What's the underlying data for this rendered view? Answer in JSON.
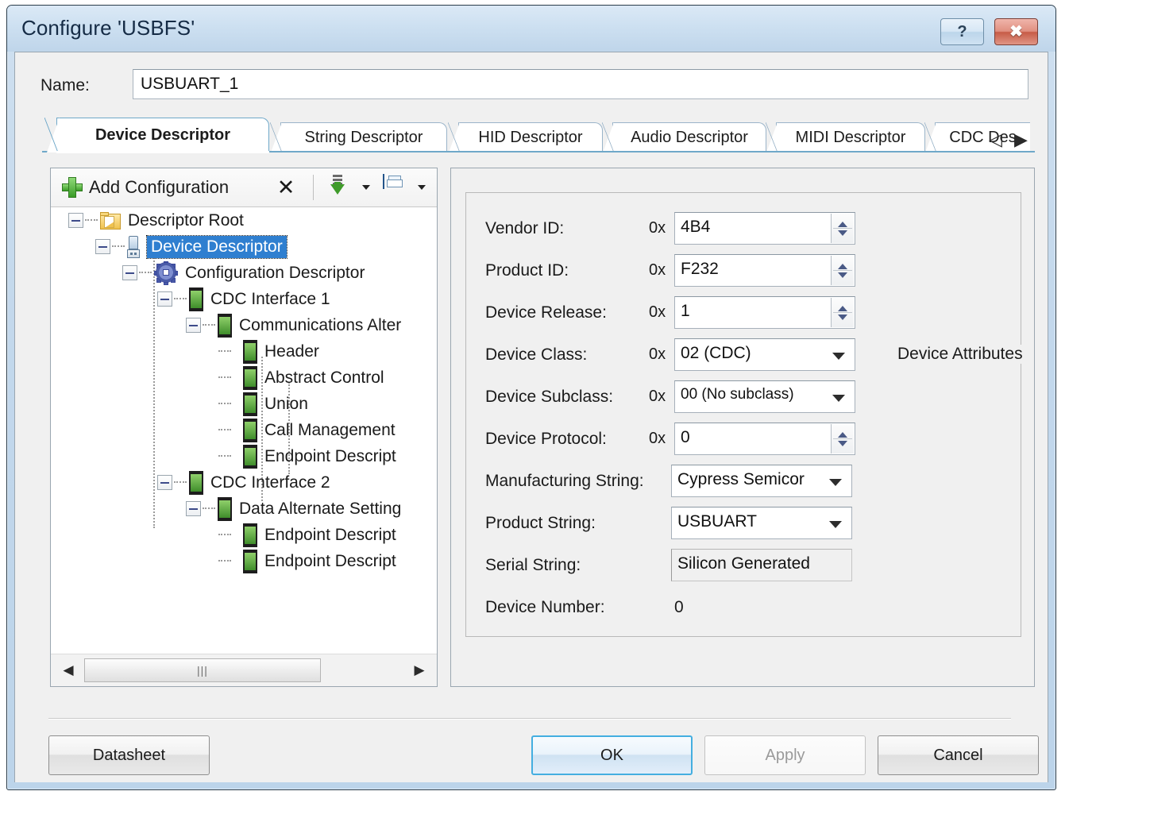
{
  "window": {
    "title": "Configure 'USBFS'",
    "help_button": "?",
    "close_button": "✖"
  },
  "name_row": {
    "label": "Name:",
    "value": "USBUART_1",
    "placeholder": "Name"
  },
  "tabs": {
    "items": [
      {
        "label": "Device Descriptor",
        "active": true
      },
      {
        "label": "String Descriptor",
        "active": false
      },
      {
        "label": "HID Descriptor",
        "active": false
      },
      {
        "label": "Audio Descriptor",
        "active": false
      },
      {
        "label": "MIDI Descriptor",
        "active": false
      },
      {
        "label": "CDC Des",
        "active": false
      }
    ],
    "scroll_left": "◁",
    "scroll_right": "▶"
  },
  "toolbar": {
    "add_configuration": "Add Configuration",
    "delete_label": "✕",
    "import_label": "",
    "save_label": ""
  },
  "tree": {
    "nodes": [
      {
        "label": "Descriptor Root",
        "depth": 0,
        "icon": "folder-icon",
        "expander": "collapse",
        "selected": false
      },
      {
        "label": "Device Descriptor",
        "depth": 1,
        "icon": "usb-device-icon",
        "expander": "collapse",
        "selected": true
      },
      {
        "label": "Configuration Descriptor",
        "depth": 2,
        "icon": "gear-icon",
        "expander": "collapse",
        "selected": false
      },
      {
        "label": "CDC Interface 1",
        "depth": 3,
        "icon": "chip-icon",
        "expander": "collapse",
        "selected": false
      },
      {
        "label": "Communications Alter",
        "depth": 4,
        "icon": "chip-icon",
        "expander": "collapse",
        "selected": false
      },
      {
        "label": "Header",
        "depth": 5,
        "icon": "chip-icon",
        "expander": "leaf",
        "selected": false
      },
      {
        "label": "Abstract Control",
        "depth": 5,
        "icon": "chip-icon",
        "expander": "leaf",
        "selected": false
      },
      {
        "label": "Union",
        "depth": 5,
        "icon": "chip-icon",
        "expander": "leaf",
        "selected": false
      },
      {
        "label": "Call Management",
        "depth": 5,
        "icon": "chip-icon",
        "expander": "leaf",
        "selected": false
      },
      {
        "label": "Endpoint Descript",
        "depth": 5,
        "icon": "chip-icon",
        "expander": "leaf",
        "selected": false
      },
      {
        "label": "CDC Interface 2",
        "depth": 3,
        "icon": "chip-icon",
        "expander": "collapse",
        "selected": false
      },
      {
        "label": "Data Alternate Setting",
        "depth": 4,
        "icon": "chip-icon",
        "expander": "collapse",
        "selected": false
      },
      {
        "label": "Endpoint Descript",
        "depth": 5,
        "icon": "chip-icon",
        "expander": "leaf",
        "selected": false
      },
      {
        "label": "Endpoint Descript",
        "depth": 5,
        "icon": "chip-icon",
        "expander": "leaf",
        "selected": false
      }
    ],
    "scrollbar": {
      "left_arrow": "◀",
      "right_arrow": "▶",
      "grip": "|||"
    }
  },
  "attributes": {
    "group_title": "Device Attributes",
    "hex_prefix": "0x",
    "fields": [
      {
        "label": "Vendor ID:",
        "hex": "0x",
        "value": "4B4",
        "control": "spinner"
      },
      {
        "label": "Product ID:",
        "hex": "0x",
        "value": "F232",
        "control": "spinner"
      },
      {
        "label": "Device Release:",
        "hex": "0x",
        "value": "1",
        "control": "spinner"
      },
      {
        "label": "Device Class:",
        "hex": "0x",
        "value": "02 (CDC)",
        "control": "dropdown"
      },
      {
        "label": "Device Subclass:",
        "hex": "0x",
        "value": "00 (No subclass)",
        "control": "dropdown"
      },
      {
        "label": "Device Protocol:",
        "hex": "0x",
        "value": "0",
        "control": "spinner"
      },
      {
        "label": "Manufacturing String:",
        "hex": "",
        "value": "Cypress Semicor",
        "control": "dropdown"
      },
      {
        "label": "Product String:",
        "hex": "",
        "value": "USBUART",
        "control": "dropdown"
      },
      {
        "label": "Serial String:",
        "hex": "",
        "value": "Silicon Generated",
        "control": "readonly"
      },
      {
        "label": "Device Number:",
        "hex": "",
        "value": "0",
        "control": "plain"
      }
    ]
  },
  "footer": {
    "datasheet": "Datasheet",
    "ok": "OK",
    "apply": "Apply",
    "cancel": "Cancel"
  },
  "colors": {
    "accent": "#2f7fd0",
    "tab_underline": "#6fa8c9",
    "ok_border": "#44aee0",
    "title_gradient_top": "#dbe9f6",
    "close_red": "#c75c47"
  }
}
